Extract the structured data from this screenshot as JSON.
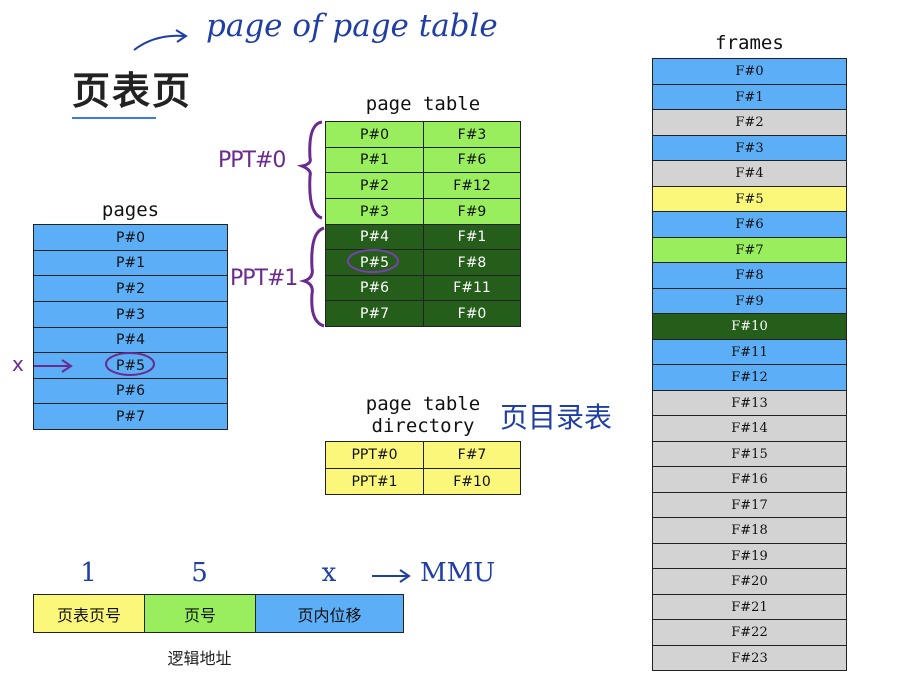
{
  "heading": {
    "title": "页表页",
    "note": "page of page table"
  },
  "pages": {
    "title": "pages",
    "items": [
      "P#0",
      "P#1",
      "P#2",
      "P#3",
      "P#4",
      "P#5",
      "P#6",
      "P#7"
    ]
  },
  "page_table": {
    "title": "page table",
    "rows": [
      {
        "page": "P#0",
        "frame": "F#3",
        "color": "#98ee5c"
      },
      {
        "page": "P#1",
        "frame": "F#6",
        "color": "#98ee5c"
      },
      {
        "page": "P#2",
        "frame": "F#12",
        "color": "#98ee5c"
      },
      {
        "page": "P#3",
        "frame": "F#9",
        "color": "#98ee5c"
      },
      {
        "page": "P#4",
        "frame": "F#1",
        "color": "#245e1a"
      },
      {
        "page": "P#5",
        "frame": "F#8",
        "color": "#245e1a"
      },
      {
        "page": "P#6",
        "frame": "F#11",
        "color": "#245e1a"
      },
      {
        "page": "P#7",
        "frame": "F#0",
        "color": "#245e1a"
      }
    ],
    "label_ppt0": "PPT#0",
    "label_ppt1": "PPT#1"
  },
  "directory": {
    "title_line1": "page table",
    "title_line2": "directory",
    "note": "页目录表",
    "rows": [
      {
        "ppt": "PPT#0",
        "frame": "F#7"
      },
      {
        "ppt": "PPT#1",
        "frame": "F#10"
      }
    ]
  },
  "frames": {
    "title": "frames",
    "items": [
      {
        "label": "F#0",
        "color": "#5caef6"
      },
      {
        "label": "F#1",
        "color": "#5caef6"
      },
      {
        "label": "F#2",
        "color": "#d3d3d3"
      },
      {
        "label": "F#3",
        "color": "#5caef6"
      },
      {
        "label": "F#4",
        "color": "#d3d3d3"
      },
      {
        "label": "F#5",
        "color": "#fbf77a"
      },
      {
        "label": "F#6",
        "color": "#5caef6"
      },
      {
        "label": "F#7",
        "color": "#98ee5c"
      },
      {
        "label": "F#8",
        "color": "#5caef6"
      },
      {
        "label": "F#9",
        "color": "#5caef6"
      },
      {
        "label": "F#10",
        "color": "#245e1a"
      },
      {
        "label": "F#11",
        "color": "#5caef6"
      },
      {
        "label": "F#12",
        "color": "#5caef6"
      },
      {
        "label": "F#13",
        "color": "#d3d3d3"
      },
      {
        "label": "F#14",
        "color": "#d3d3d3"
      },
      {
        "label": "F#15",
        "color": "#d3d3d3"
      },
      {
        "label": "F#16",
        "color": "#d3d3d3"
      },
      {
        "label": "F#17",
        "color": "#d3d3d3"
      },
      {
        "label": "F#18",
        "color": "#d3d3d3"
      },
      {
        "label": "F#19",
        "color": "#d3d3d3"
      },
      {
        "label": "F#20",
        "color": "#d3d3d3"
      },
      {
        "label": "F#21",
        "color": "#d3d3d3"
      },
      {
        "label": "F#22",
        "color": "#d3d3d3"
      },
      {
        "label": "F#23",
        "color": "#d3d3d3"
      }
    ]
  },
  "logical_address": {
    "caption": "逻辑地址",
    "fields": [
      {
        "label": "页表页号",
        "value": "1",
        "color": "#fbf77a"
      },
      {
        "label": "页号",
        "value": "5",
        "color": "#98ee5c"
      },
      {
        "label": "页内位移",
        "value": "x",
        "color": "#5caef6"
      }
    ],
    "arrow_target": "MMU"
  },
  "pointer_x": "x"
}
